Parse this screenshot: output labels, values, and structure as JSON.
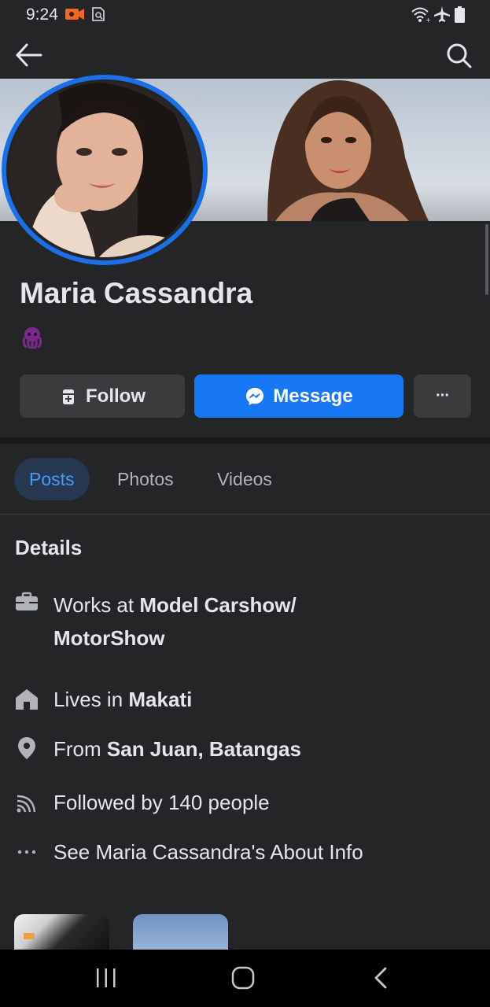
{
  "status_bar": {
    "time": "9:24",
    "icons": [
      "video-record-icon",
      "screenshot-icon",
      "wifi-icon",
      "airplane-mode-icon",
      "battery-icon"
    ]
  },
  "top_bar": {
    "back_icon": "arrow-left-icon",
    "search_icon": "search-icon"
  },
  "profile": {
    "name": "Maria Cassandra",
    "emoji_icon": "octopus-icon"
  },
  "actions": {
    "follow_label": "Follow",
    "message_label": "Message",
    "more_label": "···"
  },
  "tabs": [
    {
      "label": "Posts",
      "active": true
    },
    {
      "label": "Photos",
      "active": false
    },
    {
      "label": "Videos",
      "active": false
    }
  ],
  "details": {
    "title": "Details",
    "work_prefix": "Works at ",
    "work_place_line1": "Model Carshow/",
    "work_place_line2": "MotorShow",
    "lives_prefix": "Lives in ",
    "lives_place": "Makati",
    "from_prefix": "From ",
    "from_place": "San Juan, Batangas",
    "followers": "Followed by 140 people",
    "about_link": "See Maria Cassandra's About Info"
  },
  "colors": {
    "background": "#242526",
    "accent": "#1877f2",
    "tab_active_bg": "#263951",
    "tab_active_text": "#4599ff",
    "text": "#e4e6eb",
    "secondary_text": "#b0b3b8"
  }
}
